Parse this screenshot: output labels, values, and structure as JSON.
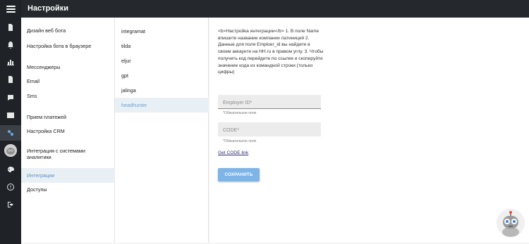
{
  "header": {
    "title": "Настройки"
  },
  "settings_menu": {
    "items": [
      {
        "label": "Дизайн веб бота"
      },
      {
        "label": "Настройка бота в браузере"
      },
      {
        "label": "Мессенджеры"
      },
      {
        "label": "Email"
      },
      {
        "label": "Sms"
      },
      {
        "label": "Прием платежей"
      },
      {
        "label": "Настройка CRM"
      },
      {
        "label": "Интеграция с системами аналитики"
      },
      {
        "label": "Интеграции"
      },
      {
        "label": "Доступы"
      }
    ],
    "selected": "Интеграции"
  },
  "integrations": {
    "items": [
      {
        "label": "integramat"
      },
      {
        "label": "tilda"
      },
      {
        "label": "eljur"
      },
      {
        "label": "gpt"
      },
      {
        "label": "jalinga"
      },
      {
        "label": "headhunter"
      }
    ],
    "selected": "headhunter"
  },
  "form": {
    "description": "<b>Настройка интеграции</b> 1. В поле Name впишите название компании латиницей 2. Данные для поля Emploer_id вы найдете в своем аккаунте на HH.ru в правом углу. 3. Чтобы получить код перейдите по ссылке и скопируйте значение кода из командной строки (только цифры)",
    "employer_id": {
      "placeholder": "Employer ID*",
      "value": "",
      "hint": "*Обязательное поле"
    },
    "code": {
      "placeholder": "CODE*",
      "value": "",
      "hint": "*Обязательное поле"
    },
    "link_label": "Get CODE link",
    "save_label": "СОХРАНИТЬ"
  },
  "rail_icons": [
    "menu-icon",
    "document-icon",
    "bell-icon",
    "bar-chart-icon",
    "file-icon",
    "chat-icon",
    "table-icon",
    "integrations-icon",
    "avatar",
    "palette-icon",
    "help-icon",
    "logout-icon"
  ],
  "colors": {
    "header": "#25292d",
    "rail": "#1f2327",
    "accent": "#7fb4e6",
    "selected_bg": "#e8f0f6"
  }
}
